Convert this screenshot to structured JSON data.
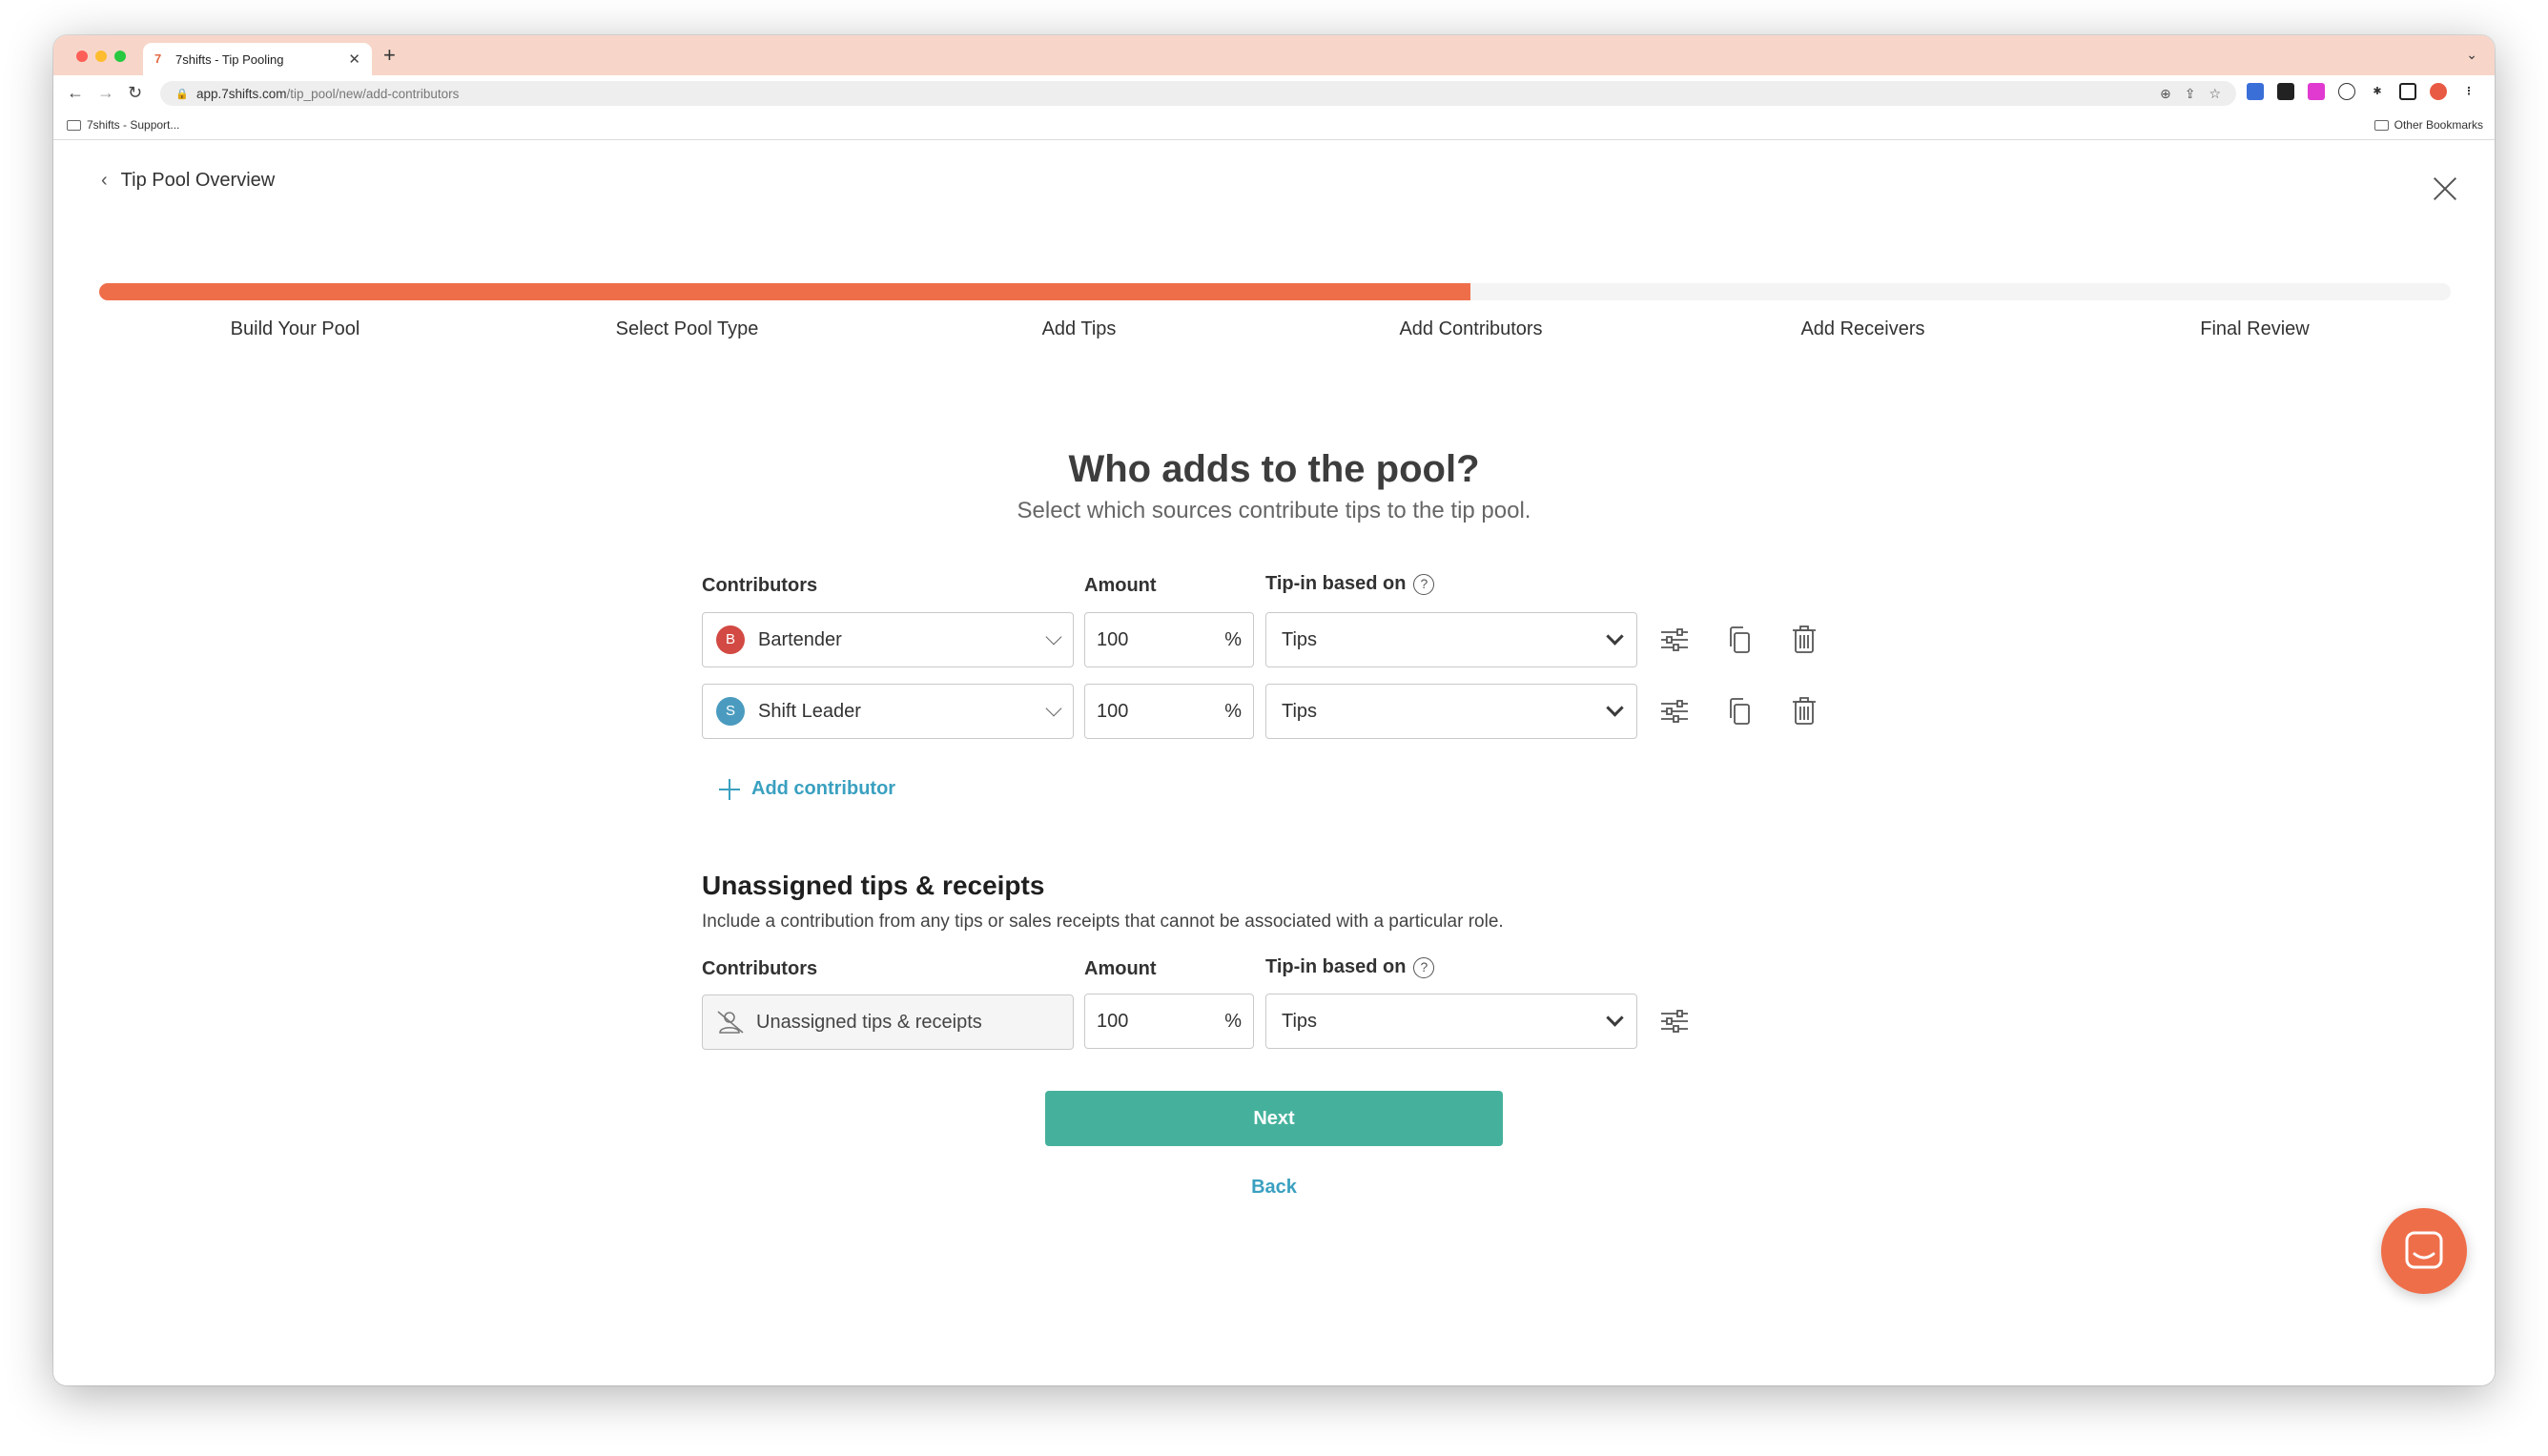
{
  "browser": {
    "tab_title": "7shifts - Tip Pooling",
    "url_host": "app.7shifts.com",
    "url_path": "/tip_pool/new/add-contributors",
    "bookmark_left": "7shifts - Support...",
    "bookmark_right": "Other Bookmarks"
  },
  "nav": {
    "back_label": "Tip Pool Overview"
  },
  "progress": {
    "fraction": 0.583,
    "steps": [
      "Build Your Pool",
      "Select Pool Type",
      "Add Tips",
      "Add Contributors",
      "Add Receivers",
      "Final Review"
    ]
  },
  "main": {
    "title": "Who adds to the pool?",
    "subtitle": "Select which sources contribute tips to the tip pool."
  },
  "contributors_table": {
    "col_contributors": "Contributors",
    "col_amount": "Amount",
    "col_tipin": "Tip-in based on",
    "help": "?",
    "rows": [
      {
        "badge": "B",
        "badge_color": "#d24a43",
        "role": "Bartender",
        "amount": "100",
        "unit": "%",
        "tipin": "Tips"
      },
      {
        "badge": "S",
        "badge_color": "#4a9bbf",
        "role": "Shift Leader",
        "amount": "100",
        "unit": "%",
        "tipin": "Tips"
      }
    ],
    "add_label": "Add contributor"
  },
  "unassigned": {
    "title": "Unassigned tips & receipts",
    "description": "Include a contribution from any tips or sales receipts that cannot be associated with a particular role.",
    "col_contributors": "Contributors",
    "col_amount": "Amount",
    "col_tipin": "Tip-in based on",
    "help": "?",
    "row": {
      "label": "Unassigned tips & receipts",
      "amount": "100",
      "unit": "%",
      "tipin": "Tips"
    }
  },
  "actions": {
    "next_label": "Next",
    "back_label": "Back"
  },
  "colors": {
    "accent": "#ef6e4a",
    "primary_button": "#45b19c",
    "link": "#3aa0c0"
  }
}
